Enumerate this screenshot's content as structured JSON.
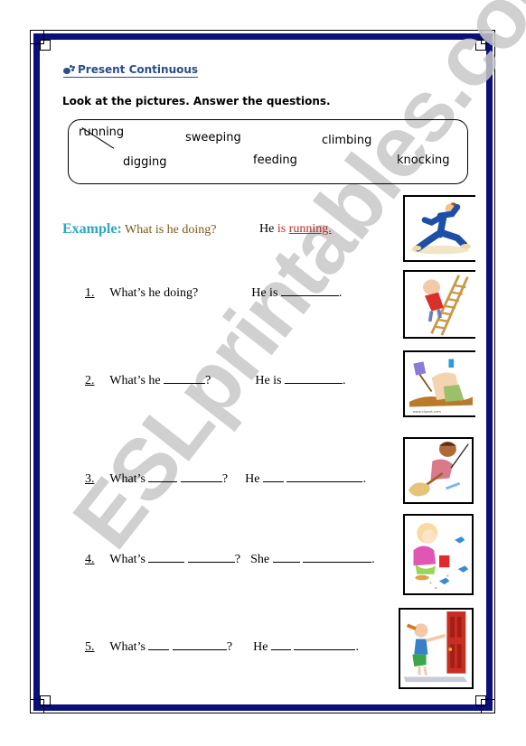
{
  "worksheet": {
    "title": "Present Continuous",
    "title_icon": "footprints-icon",
    "instructions": "Look at the pictures. Answer the questions.",
    "word_bank": [
      {
        "word": "running",
        "crossed_out": true
      },
      {
        "word": "sweeping",
        "crossed_out": false
      },
      {
        "word": "climbing",
        "crossed_out": false
      },
      {
        "word": "digging",
        "crossed_out": false
      },
      {
        "word": "feeding",
        "crossed_out": false
      },
      {
        "word": "knocking",
        "crossed_out": false
      }
    ],
    "example": {
      "label": "Example:",
      "question": "What is he doing?",
      "answer_subject": "He",
      "answer_verb": "is",
      "answer_word": "running.",
      "picture": "man-running-picture"
    },
    "colors": {
      "border": "#0a0f7a",
      "title": "#2b4d8c",
      "example_label": "#2ba7c1",
      "example_question": "#7a5a1a",
      "example_answer": "#c0282d",
      "watermark": "#c8c8c8"
    },
    "questions": [
      {
        "number": "1.",
        "q_parts": [
          "What’s he doing?"
        ],
        "a_parts": [
          "He is"
        ],
        "picture": "man-climbing-ladder-picture"
      },
      {
        "number": "2.",
        "q_parts": [
          "What’s he",
          "?"
        ],
        "a_parts": [
          "He is"
        ],
        "picture": "man-digging-picture"
      },
      {
        "number": "3.",
        "q_parts": [
          "What’s",
          "?"
        ],
        "a_parts": [
          "He"
        ],
        "picture": "boy-sweeping-picture"
      },
      {
        "number": "4.",
        "q_parts": [
          "What’s",
          "?"
        ],
        "a_parts": [
          "She"
        ],
        "picture": "girl-feeding-birds-picture"
      },
      {
        "number": "5.",
        "q_parts": [
          "What’s",
          "?"
        ],
        "a_parts": [
          "He"
        ],
        "picture": "man-knocking-door-picture"
      }
    ],
    "watermark": "ESLprintables.com"
  }
}
